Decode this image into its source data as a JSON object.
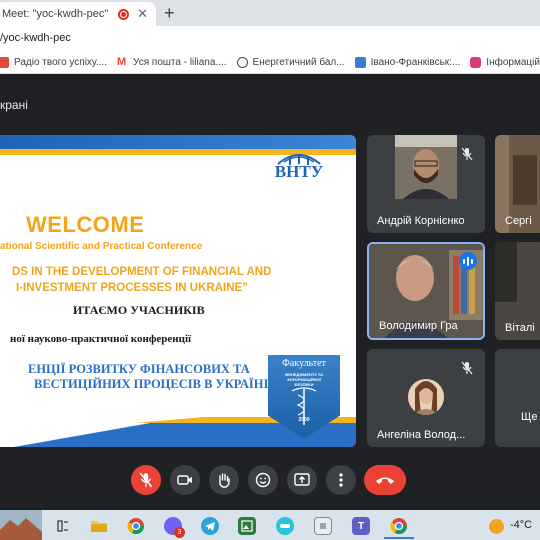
{
  "browser": {
    "tab_title": "Meet: \"yoc-kwdh-pec\"",
    "new_tab_symbol": "+",
    "tab_close_symbol": "✕",
    "url": "/yoc-kwdh-pec",
    "bookmarks": [
      {
        "label": "Радіо твого успіху....",
        "icon": "radio-icon",
        "color": "#e04b3a"
      },
      {
        "label": "Уся пошта - liliana....",
        "icon": "gmail-icon",
        "color": "#ea4335"
      },
      {
        "label": "Енергетичний бал...",
        "icon": "globe-icon",
        "color": "#4a4a4a"
      },
      {
        "label": "Івано-Франківськ:...",
        "icon": "map-icon",
        "color": "#3a7bd5"
      },
      {
        "label": "Інформаційна пан...",
        "icon": "puzzle-icon",
        "color": "#d93a7e"
      }
    ]
  },
  "meet": {
    "presentation_label": "крані",
    "participants": [
      {
        "name": "Андрій Корнієнко",
        "mic": "muted"
      },
      {
        "name": "Сергі",
        "mic": "none"
      },
      {
        "name": "Володимир Гра",
        "mic": "speaking"
      },
      {
        "name": "Віталі",
        "mic": "none"
      },
      {
        "name": "Ангеліна Волод...",
        "mic": "muted"
      },
      {
        "name": "Ще",
        "mic": "none"
      }
    ]
  },
  "slide": {
    "logo_text": "ВНТУ",
    "welcome": "WELCOME",
    "conference": "ational Scientific and Practical Conference",
    "trends_line1": "DS IN THE DEVELOPMENT OF FINANCIAL AND",
    "trends_line2": "I-INVESTMENT PROCESSES IN UKRAINE”",
    "vitaemo": "ИТАЄМО УЧАСНИКІВ",
    "ua_conference": "ної науково-практичної конференції",
    "ua_line1": "ЕНЦІЇ РОЗВИТКУ ФІНАНСОВИХ ТА",
    "ua_line2": "ВЕСТИЦІЙНИХ ПРОЦЕСІВ В УКРАЇНІ»",
    "faculty_title": "Факультет",
    "faculty_sub": "МЕНЕДЖМЕНТУ ТА ІНФОРМАЦІЙНОЇ БЕЗПЕКИ",
    "faculty_year": "2000"
  },
  "taskbar": {
    "temperature": "-4°C",
    "viber_badge": "3"
  },
  "colors": {
    "meet_bg": "#202124",
    "tile_bg": "#3c4043",
    "end_call": "#ea4335",
    "accent_blue": "#1a73e8",
    "slide_gold": "#f2a51c",
    "slide_blue": "#2a6fc6"
  }
}
